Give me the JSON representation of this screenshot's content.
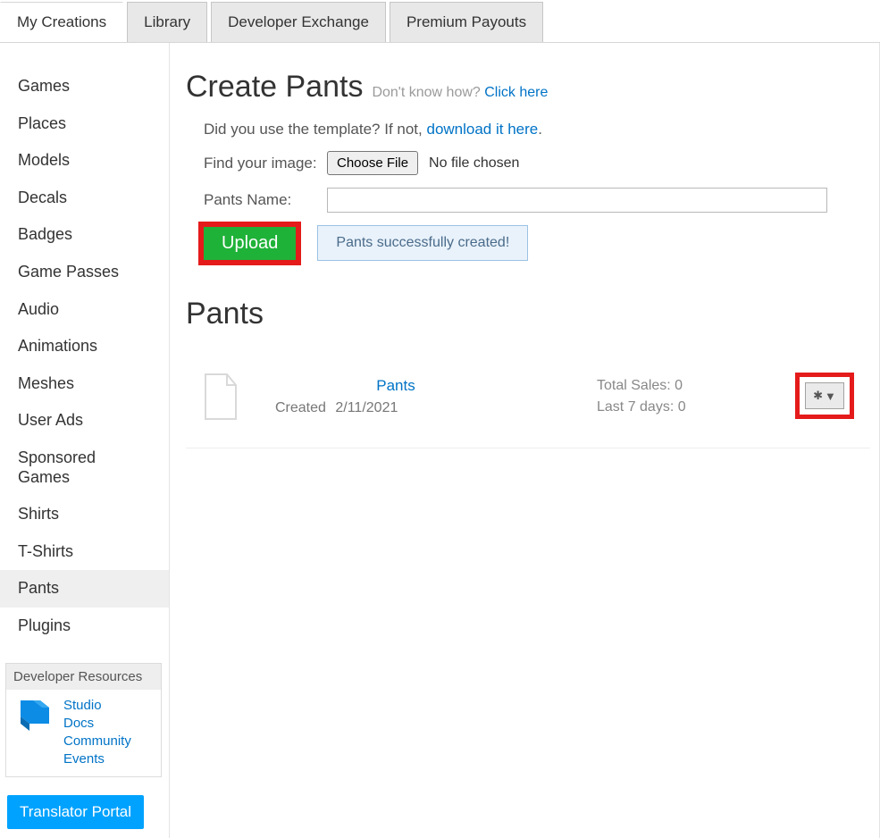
{
  "tabs": {
    "my_creations": "My Creations",
    "library": "Library",
    "developer_exchange": "Developer Exchange",
    "premium_payouts": "Premium Payouts"
  },
  "sidebar": {
    "items": [
      {
        "label": "Games"
      },
      {
        "label": "Places"
      },
      {
        "label": "Models"
      },
      {
        "label": "Decals"
      },
      {
        "label": "Badges"
      },
      {
        "label": "Game Passes"
      },
      {
        "label": "Audio"
      },
      {
        "label": "Animations"
      },
      {
        "label": "Meshes"
      },
      {
        "label": "User Ads"
      },
      {
        "label": "Sponsored Games"
      },
      {
        "label": "Shirts"
      },
      {
        "label": "T-Shirts"
      },
      {
        "label": "Pants"
      },
      {
        "label": "Plugins"
      }
    ],
    "selected_index": 13,
    "dev_resources_title": "Developer Resources",
    "dev_links": {
      "studio": "Studio",
      "docs": "Docs",
      "community": "Community",
      "events": "Events"
    },
    "translator_portal": "Translator Portal"
  },
  "create": {
    "title": "Create Pants",
    "hint_prefix": "Don't know how? ",
    "hint_link": "Click here",
    "template_prefix": "Did you use the template? If not, ",
    "template_link": "download it here",
    "template_suffix": ".",
    "find_image_label": "Find your image:",
    "choose_file_btn": "Choose File",
    "file_status": "No file chosen",
    "name_label": "Pants Name:",
    "name_value": "",
    "upload_btn": "Upload",
    "success_msg": "Pants successfully created!"
  },
  "list": {
    "title": "Pants",
    "items": [
      {
        "name": "Pants",
        "created_label": "Created",
        "created_date": "2/11/2021",
        "total_sales_label": "Total Sales:",
        "total_sales_value": "0",
        "last7_label": "Last 7 days:",
        "last7_value": "0"
      }
    ]
  }
}
